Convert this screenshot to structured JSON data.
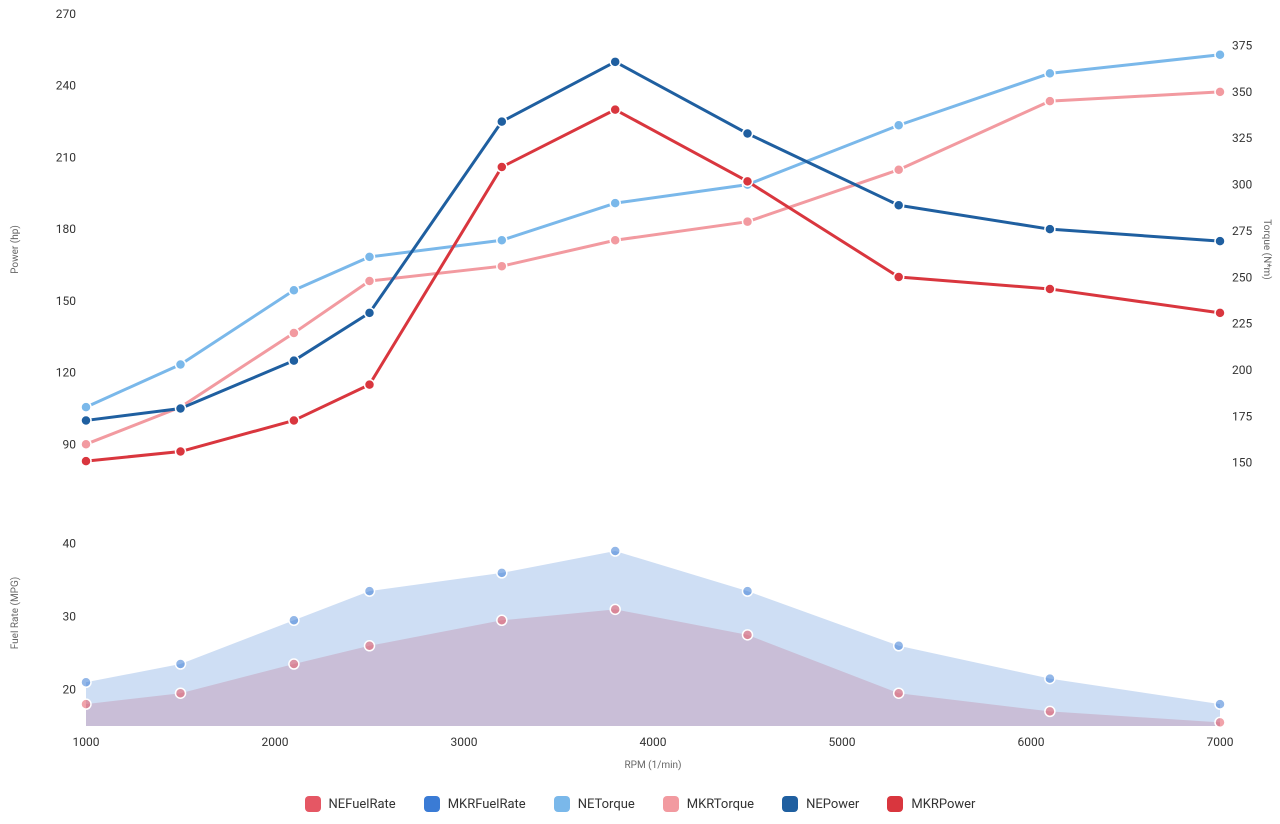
{
  "chart_data": {
    "type": "line",
    "x": [
      1000,
      1500,
      2100,
      2500,
      3200,
      3800,
      4500,
      5300,
      6100,
      7000
    ],
    "xlabel": "RPM (1/min)",
    "left_axes": {
      "power": {
        "label": "Power (hp)",
        "ticks": [
          90,
          120,
          150,
          180,
          210,
          240,
          270
        ],
        "range": [
          73,
          270
        ]
      },
      "fuel": {
        "label": "Fuel Rate (MPG)",
        "ticks": [
          20,
          30,
          40
        ],
        "range": [
          15,
          46
        ]
      }
    },
    "right_axis": {
      "label": "Torque (N*m)",
      "ticks": [
        150,
        175,
        200,
        225,
        250,
        275,
        300,
        325,
        350,
        375
      ],
      "range": [
        138,
        392
      ]
    },
    "x_ticks": [
      1000,
      2000,
      3000,
      4000,
      5000,
      6000,
      7000
    ],
    "series": [
      {
        "name": "NEFuelRate",
        "axis": "fuel",
        "color": "#e55764",
        "fill": true,
        "values": [
          18,
          19.5,
          23.5,
          26,
          29.5,
          31,
          27.5,
          19.5,
          17,
          15.5
        ]
      },
      {
        "name": "MKRFuelRate",
        "axis": "fuel",
        "color": "#3a7bd5",
        "fill": true,
        "values": [
          21,
          23.5,
          29.5,
          33.5,
          36,
          39,
          33.5,
          26,
          21.5,
          18
        ]
      },
      {
        "name": "NETorque",
        "axis": "torque",
        "color": "#7ab8ea",
        "fill": false,
        "values": [
          180,
          203,
          243,
          261,
          270,
          290,
          300,
          332,
          360,
          370
        ]
      },
      {
        "name": "MKRTorque",
        "axis": "torque",
        "color": "#f29aa0",
        "fill": false,
        "values": [
          160,
          180,
          220,
          248,
          256,
          270,
          280,
          308,
          345,
          350
        ]
      },
      {
        "name": "NEPower",
        "axis": "power",
        "color": "#1f5fa0",
        "fill": false,
        "values": [
          100,
          105,
          125,
          145,
          225,
          250,
          220,
          190,
          180,
          175
        ]
      },
      {
        "name": "MKRPower",
        "axis": "power",
        "color": "#d9363e",
        "fill": false,
        "values": [
          83,
          87,
          100,
          115,
          206,
          230,
          200,
          160,
          155,
          145
        ]
      }
    ],
    "legend_order": [
      "NEFuelRate",
      "MKRFuelRate",
      "NETorque",
      "MKRTorque",
      "NEPower",
      "MKRPower"
    ],
    "legend_colors": {
      "NEFuelRate": "#e55764",
      "MKRFuelRate": "#3a7bd5",
      "NETorque": "#7ab8ea",
      "MKRTorque": "#f29aa0",
      "NEPower": "#1f5fa0",
      "MKRPower": "#d9363e"
    }
  }
}
